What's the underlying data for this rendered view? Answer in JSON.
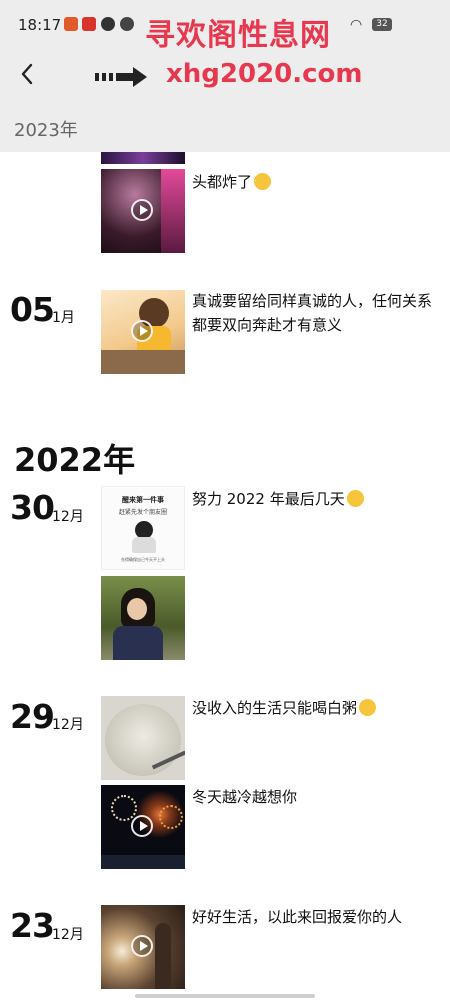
{
  "status": {
    "time": "18:17",
    "battery": "32",
    "watermark": "寻欢阁性息网"
  },
  "nav": {
    "watermark_url": "xhg2020.com"
  },
  "sticky_year": "2023年",
  "year_2022": "2022年",
  "posts": [
    {
      "caption": "头都炸了"
    },
    {
      "day": "05",
      "month": "1月",
      "caption": "真诚要留给同样真诚的人，任何关系都要双向奔赴才有意义"
    },
    {
      "day": "30",
      "month": "12月",
      "caption": "努力 2022 年最后几天"
    },
    {
      "day": "29",
      "month": "12月",
      "caption": "没收入的生活只能喝白粥",
      "caption2": "冬天越冷越想你"
    },
    {
      "day": "23",
      "month": "12月",
      "caption": "好好生活，以此来回报爱你的人"
    }
  ],
  "poster": {
    "line1": "醒来第一件事",
    "line2": "赶紧先发个朋友圈",
    "line3": "先得确保自己今天不上头"
  },
  "colors": {
    "accent": "#e8384f",
    "topbar": "#ededed"
  }
}
